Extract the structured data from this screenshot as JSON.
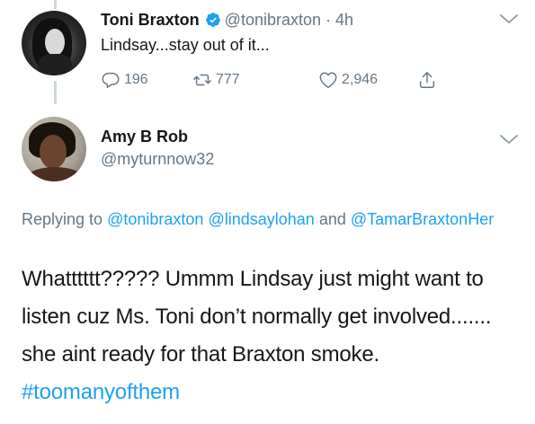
{
  "parent_tweet": {
    "name": "Toni Braxton",
    "handle": "@tonibraxton",
    "separator": "·",
    "time": "4h",
    "text": "Lindsay...stay out of it...",
    "reply_count": "196",
    "retweet_count": "777",
    "like_count": "2,946"
  },
  "reply_tweet": {
    "name": "Amy B Rob",
    "handle": "@myturnnow32",
    "replying_prefix": "Replying to",
    "mentions": [
      "@tonibraxton",
      "@lindsaylohan",
      "@TamarBraxtonHer"
    ],
    "and_word": "and",
    "body_text": "Whatttttt????? Ummm Lindsay just might want to listen cuz Ms. Toni don’t normally get involved....... she aint ready for that Braxton smoke.",
    "hashtag": "#toomanyofthem"
  },
  "colors": {
    "link": "#1da1f2",
    "secondary_text": "#657786",
    "primary_text": "#14171a",
    "verified_badge": "#1da1f2"
  },
  "icons": {
    "reply": "reply-icon",
    "retweet": "retweet-icon",
    "like": "heart-icon",
    "share": "share-icon",
    "verified": "verified-badge-icon",
    "menu": "chevron-down-icon"
  }
}
